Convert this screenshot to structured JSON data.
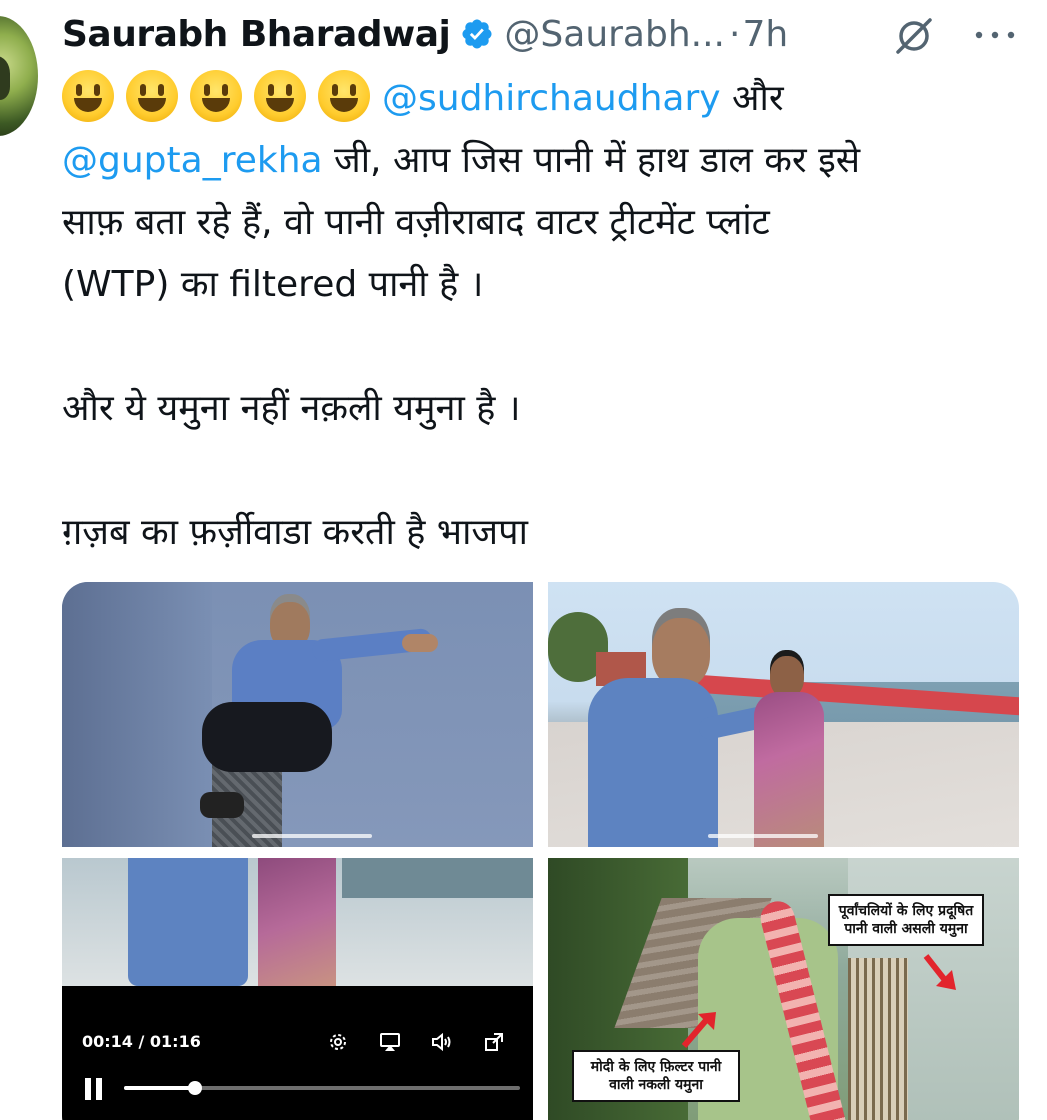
{
  "author": {
    "name": "Saurabh Bharadwaj",
    "handle": "@Saurabh...",
    "separator": "·",
    "time": "7h",
    "avatar_icon": "avatar-photo",
    "verified_icon": "verified-badge-icon"
  },
  "actions": {
    "grok_icon": "grok-icon",
    "more_icon": "more-icon"
  },
  "tweet": {
    "line1_mention": "@sudhirchaudhary",
    "line1_rest": " और",
    "line2_mention": "@gupta_rekha",
    "line2_rest": " जी, आप जिस पानी में हाथ डाल कर इसे",
    "line3": "साफ़ बता रहे हैं, वो पानी वज़ीराबाद वाटर ट्रीटमेंट प्लांट",
    "line4": "(WTP)  का filtered पानी है ।",
    "line5": "और ये यमुना नहीं नक़ली यमुना है ।",
    "line6": "ग़ज़ब का फ़र्ज़ीवाडा करती है भाजपा"
  },
  "media": {
    "caption_right": "पूर्वांचलियों के लिए प्रदूषित पानी वाली असली यमुना",
    "caption_left": "मोदी के लिए फ़िल्टर पानी वाली नकली यमुना",
    "video": {
      "time_display": "00:14 / 01:16",
      "progress": 0.18
    }
  },
  "colors": {
    "link": "#1d9bf0",
    "secondary_text": "#536471",
    "verified": "#1d9bf0"
  }
}
